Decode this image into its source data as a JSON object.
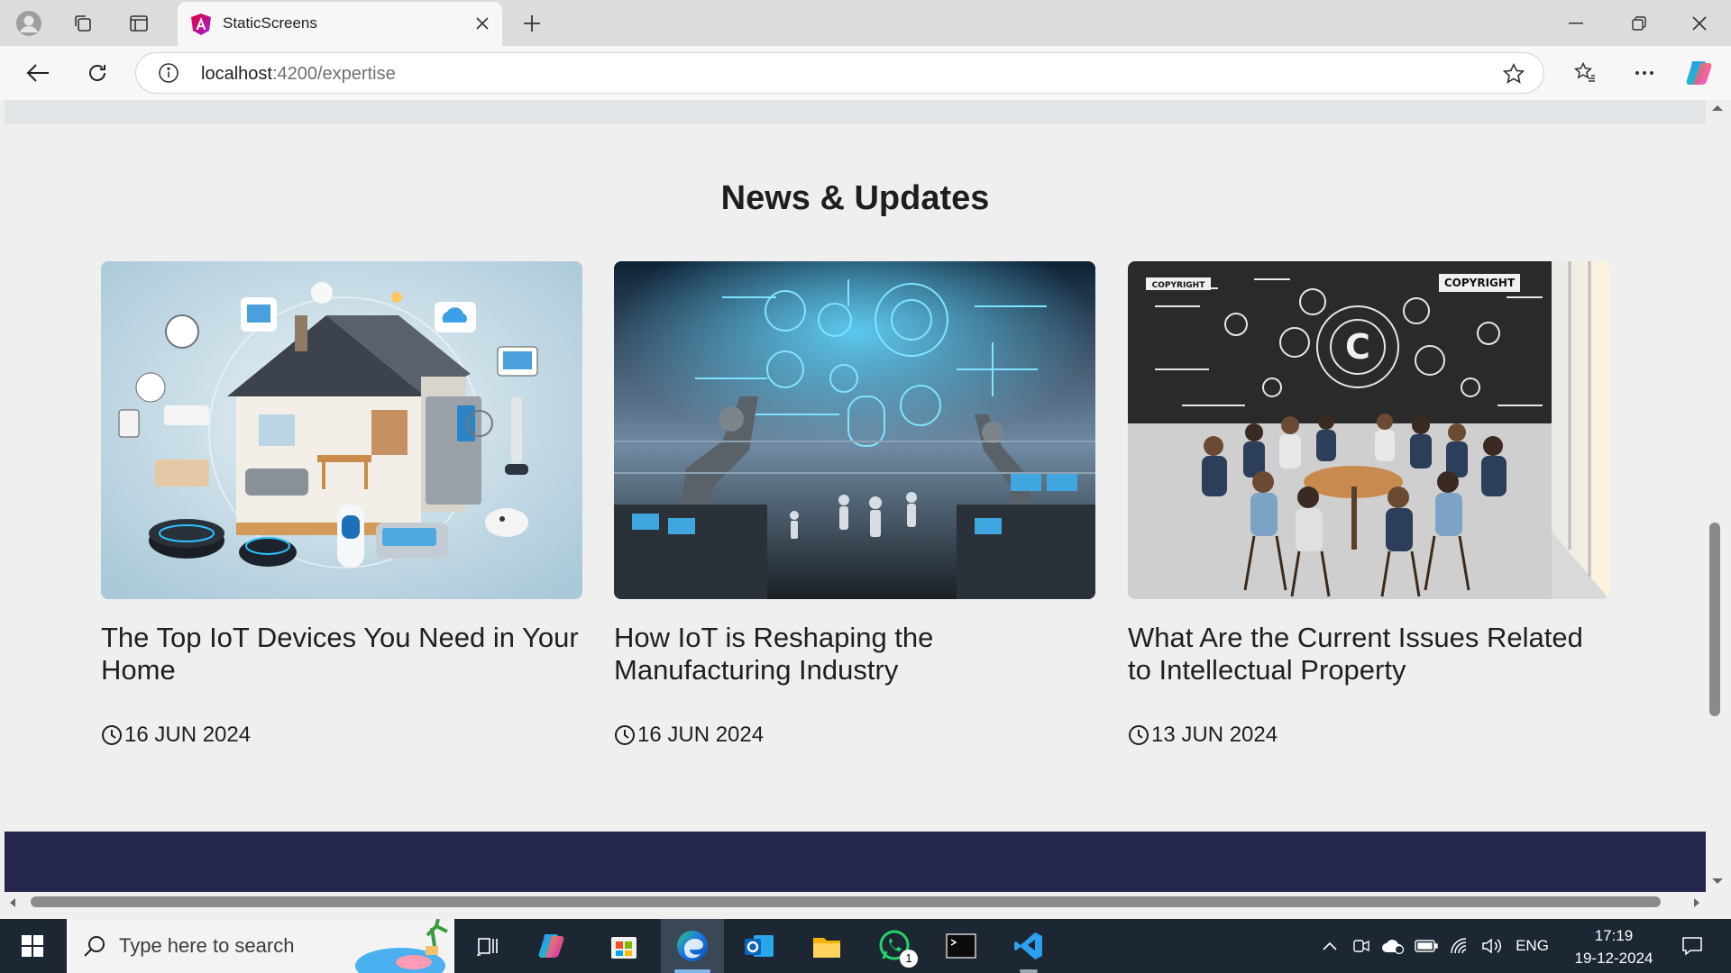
{
  "browser": {
    "tab_title": "StaticScreens",
    "url_host": "localhost",
    "url_path": ":4200/expertise"
  },
  "page": {
    "section_title": "News & Updates",
    "articles": [
      {
        "title": "The Top IoT Devices You Need in Your Home",
        "date": "16 JUN 2024",
        "image": "smart-home-iot-devices-illustration"
      },
      {
        "title": "How IoT is Reshaping the Manufacturing Industry",
        "date": "16 JUN 2024",
        "image": "robotic-factory-iot-illustration"
      },
      {
        "title": "What Are the Current Issues Related to Intellectual Property",
        "date": "13 JUN 2024",
        "image": "copyright-meeting-illustration"
      }
    ],
    "image_texts": [
      "COPYRIGHT",
      "COPYRIGHT"
    ]
  },
  "taskbar": {
    "search_placeholder": "Type here to search",
    "whatsapp_badge": "1",
    "language": "ENG",
    "time": "17:19",
    "date": "19-12-2024"
  },
  "colors": {
    "footer_band": "#25264d",
    "taskbar": "#1c2733",
    "accent_edge": "#1a73e8"
  }
}
